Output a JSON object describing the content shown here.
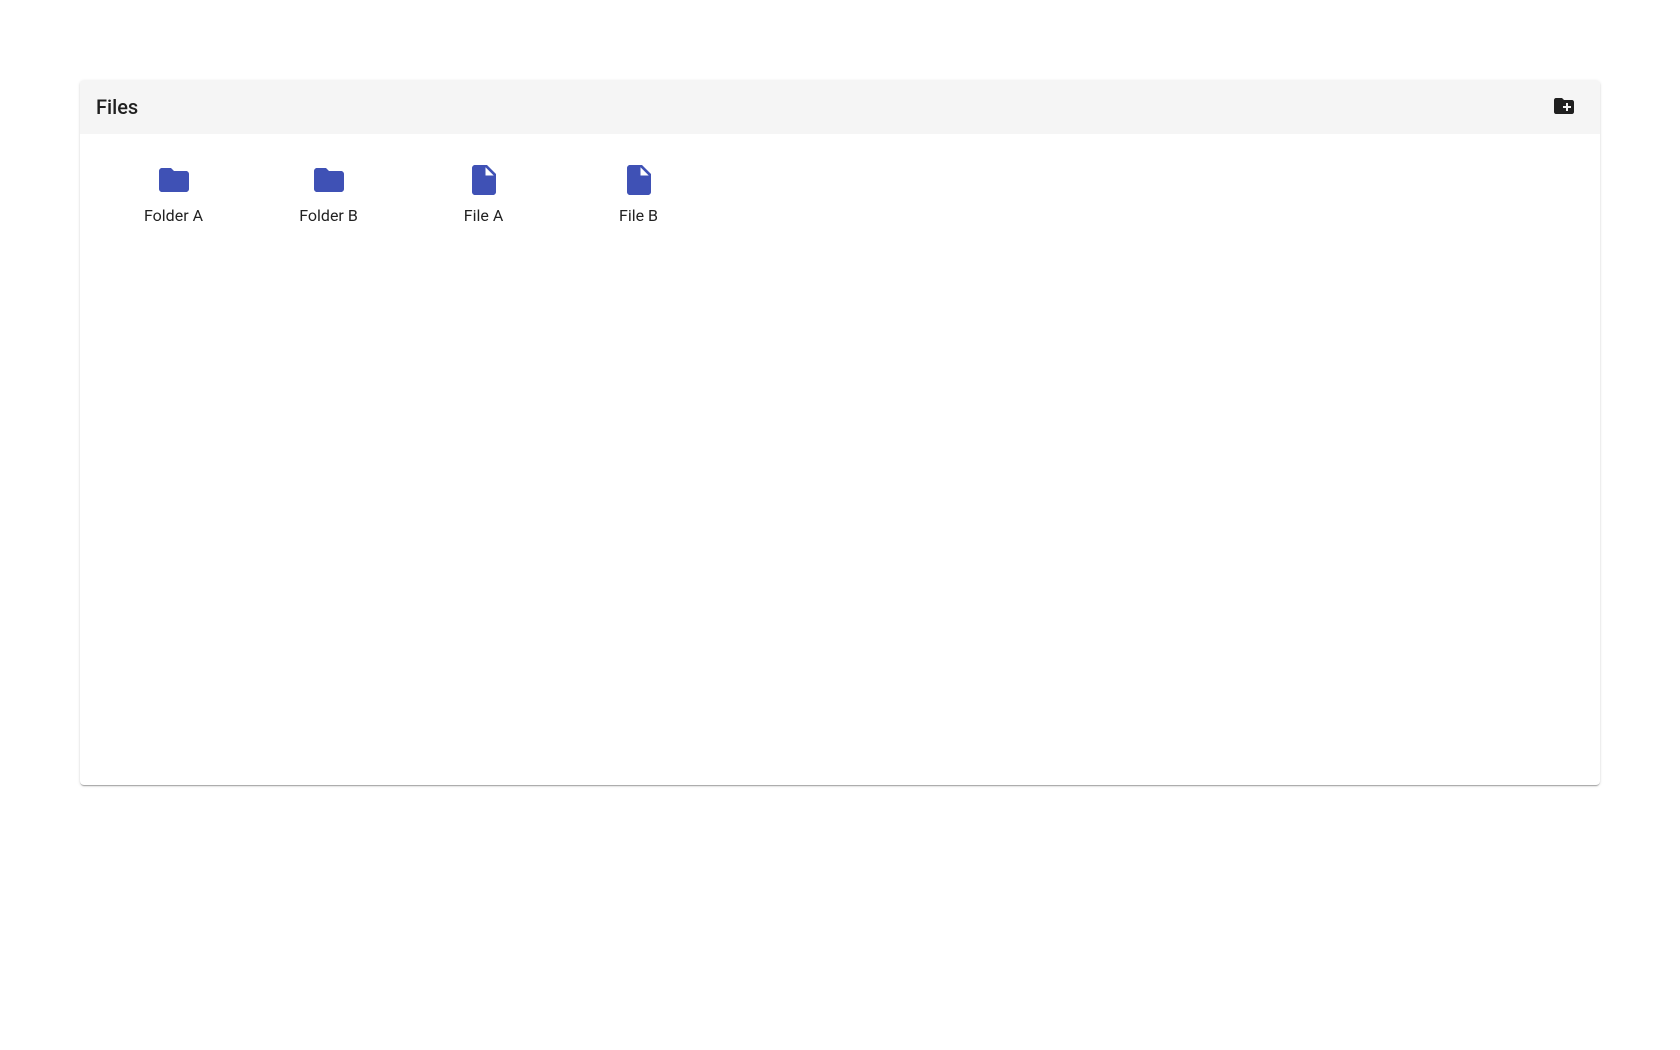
{
  "toolbar": {
    "title": "Files"
  },
  "items": [
    {
      "type": "folder",
      "label": "Folder A"
    },
    {
      "type": "folder",
      "label": "Folder B"
    },
    {
      "type": "file",
      "label": "File A"
    },
    {
      "type": "file",
      "label": "File B"
    }
  ],
  "colors": {
    "accent": "#3f51b5"
  }
}
